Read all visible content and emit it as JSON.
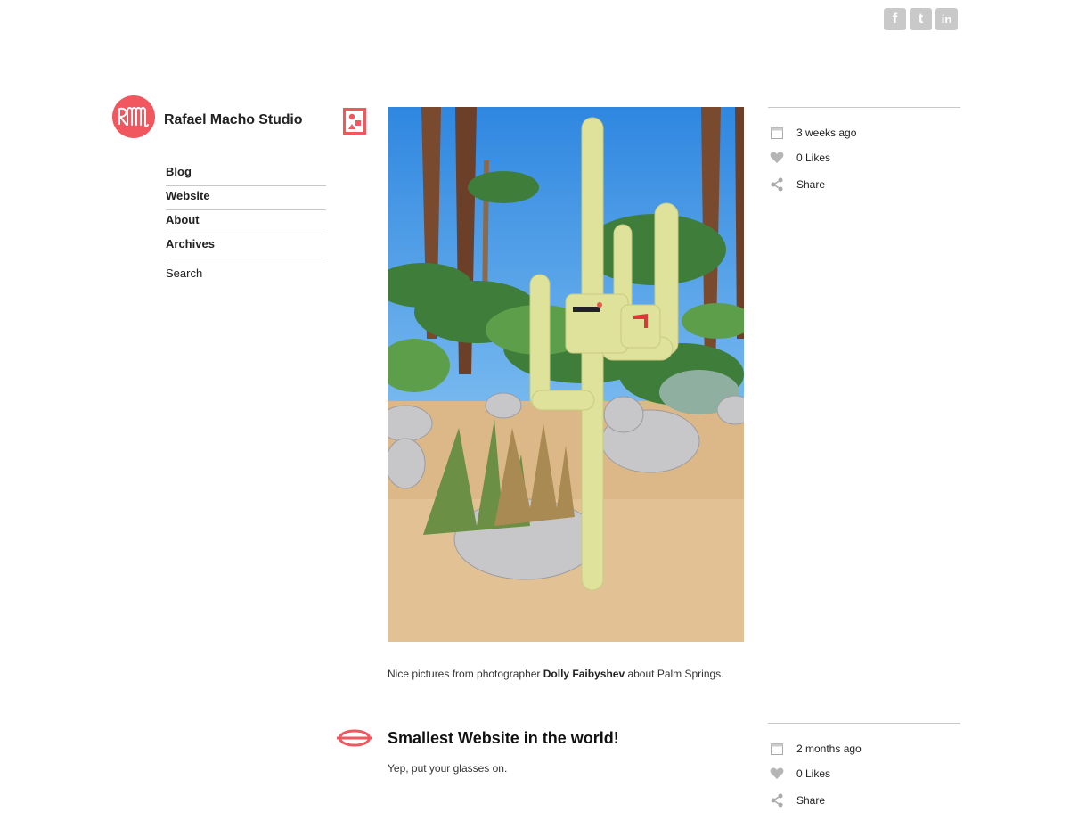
{
  "social": {
    "facebook": "f",
    "twitter": "t",
    "linkedin": "in"
  },
  "brand": {
    "name": "Rafael Macho Studio",
    "accent": "#f0575e"
  },
  "nav": {
    "items": [
      {
        "label": "Blog"
      },
      {
        "label": "Website"
      },
      {
        "label": "About"
      },
      {
        "label": "Archives"
      }
    ],
    "search": "Search"
  },
  "posts": [
    {
      "caption_pre": "Nice pictures from photographer ",
      "caption_bold": "Dolly Faibyshev",
      "caption_post": " about Palm Springs.",
      "meta": {
        "time": "3 weeks ago",
        "likes": "0 Likes",
        "share": "Share"
      }
    },
    {
      "title": "Smallest Website in the world!",
      "body": "Yep, put your glasses on.",
      "meta": {
        "time": "2 months ago",
        "likes": "0 Likes",
        "share": "Share"
      }
    }
  ]
}
